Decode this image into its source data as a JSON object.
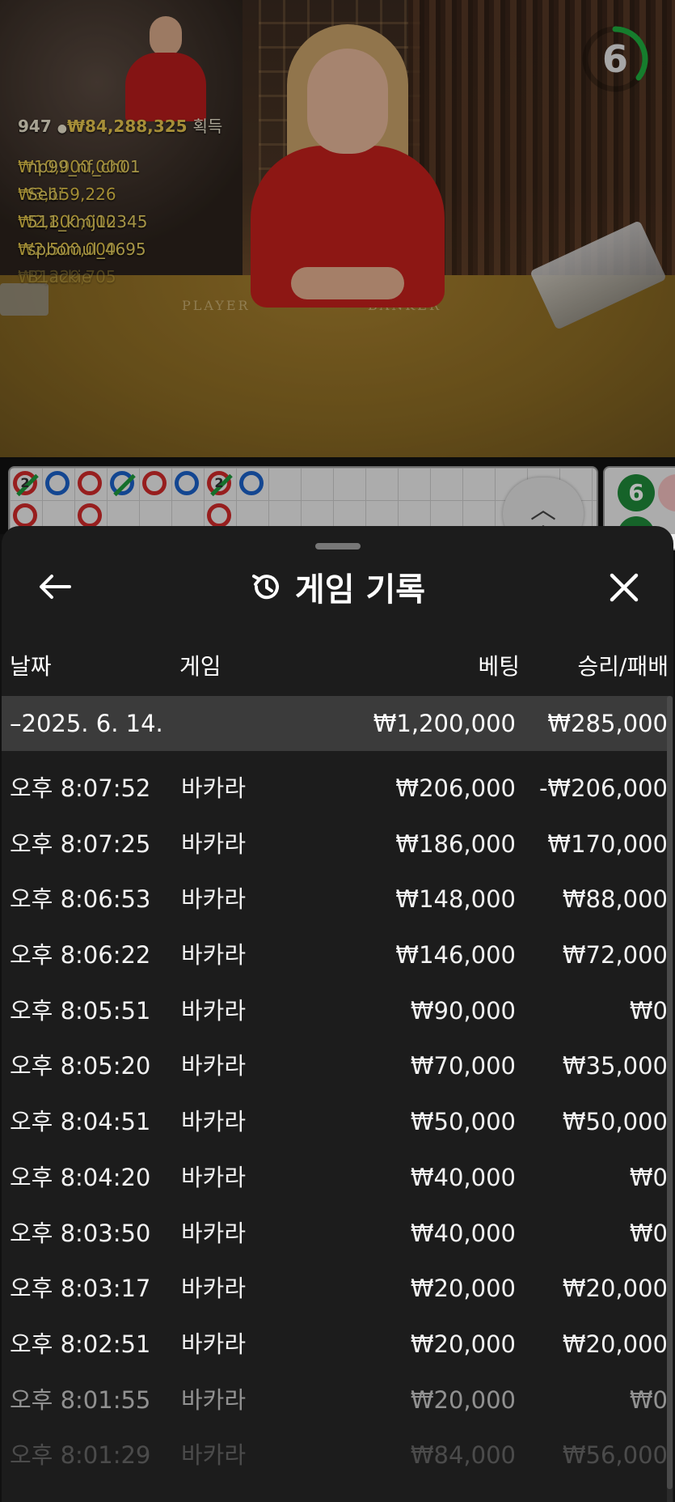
{
  "video": {
    "table_labels": {
      "player": "PLAYER",
      "banker": "BANKER"
    },
    "timer": {
      "seconds": "6",
      "color": "#1fae3f"
    },
    "winners": {
      "count": "947",
      "total": "₩84,288,325",
      "suffix": "획득",
      "rows": [
        {
          "amount": "₩10,000,000",
          "name": "np99_nf_ch01"
        },
        {
          "amount": "₩3,159,226",
          "name": "Sebi"
        },
        {
          "amount": "₩2,800,000",
          "name": "511_kmj12345"
        },
        {
          "amount": "₩2,500,000",
          "name": "spbomul_4695"
        },
        {
          "amount": "₩2,229,705",
          "name": "B1ackie"
        }
      ]
    },
    "road": {
      "tie_labels": [
        "2",
        "2"
      ],
      "side_value": "6"
    }
  },
  "sheet": {
    "title": "게임 기록",
    "icons": {
      "back": "arrow-left-icon",
      "history": "history-icon",
      "close": "close-icon"
    },
    "columns": {
      "date": "날짜",
      "game": "게임",
      "bet": "베팅",
      "result": "승리/패배"
    },
    "group": {
      "date": "–2025. 6. 14.",
      "bet": "₩1,200,000",
      "result": "₩285,000"
    },
    "rows": [
      {
        "time": "오후 8:07:52",
        "game": "바카라",
        "bet": "₩206,000",
        "result": "-₩206,000"
      },
      {
        "time": "오후 8:07:25",
        "game": "바카라",
        "bet": "₩186,000",
        "result": "₩170,000"
      },
      {
        "time": "오후 8:06:53",
        "game": "바카라",
        "bet": "₩148,000",
        "result": "₩88,000"
      },
      {
        "time": "오후 8:06:22",
        "game": "바카라",
        "bet": "₩146,000",
        "result": "₩72,000"
      },
      {
        "time": "오후 8:05:51",
        "game": "바카라",
        "bet": "₩90,000",
        "result": "₩0"
      },
      {
        "time": "오후 8:05:20",
        "game": "바카라",
        "bet": "₩70,000",
        "result": "₩35,000"
      },
      {
        "time": "오후 8:04:51",
        "game": "바카라",
        "bet": "₩50,000",
        "result": "₩50,000"
      },
      {
        "time": "오후 8:04:20",
        "game": "바카라",
        "bet": "₩40,000",
        "result": "₩0"
      },
      {
        "time": "오후 8:03:50",
        "game": "바카라",
        "bet": "₩40,000",
        "result": "₩0"
      },
      {
        "time": "오후 8:03:17",
        "game": "바카라",
        "bet": "₩20,000",
        "result": "₩20,000"
      },
      {
        "time": "오후 8:02:51",
        "game": "바카라",
        "bet": "₩20,000",
        "result": "₩20,000"
      },
      {
        "time": "오후 8:01:55",
        "game": "바카라",
        "bet": "₩20,000",
        "result": "₩0"
      },
      {
        "time": "오후 8:01:29",
        "game": "바카라",
        "bet": "₩84,000",
        "result": "₩56,000"
      }
    ]
  }
}
